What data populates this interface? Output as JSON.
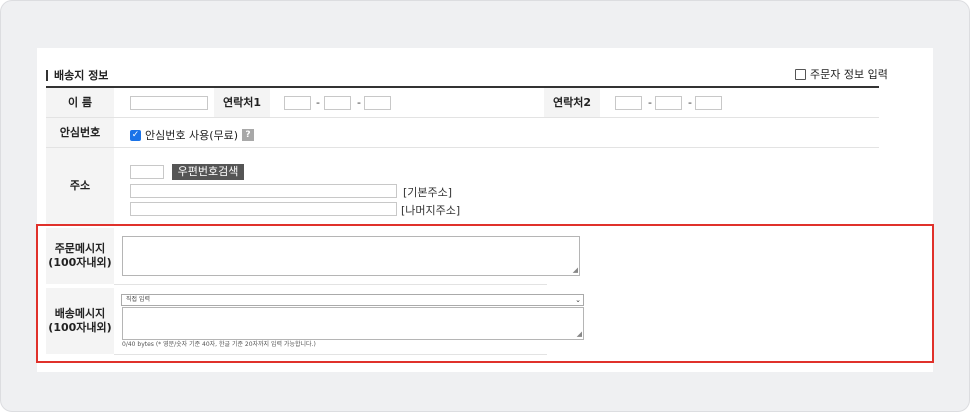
{
  "section": {
    "title": "배송지 정보",
    "orderer_checkbox_label": "주문자 정보 입력"
  },
  "fields": {
    "name_label": "이 름",
    "contact1_label": "연락처1",
    "contact2_label": "연락처2",
    "dash": "-",
    "safe_number_label": "안심번호",
    "safe_number_checkbox": "안심번호 사용(무료)",
    "help_icon_glyph": "?",
    "address_label": "주소",
    "zip_search_button": "우편번호검색",
    "base_address_hint": "[기본주소]",
    "detail_address_hint": "[나머지주소]",
    "order_message_label_line1": "주문메시지",
    "order_message_label_line2": "(100자내외)",
    "delivery_message_label_line1": "배송메시지",
    "delivery_message_label_line2": "(100자내외)",
    "delivery_select_value": "직접 입력",
    "bytes_info": "0/40 bytes (* 영문/숫자 기준 40자, 한글 기준 20자까지 입력 가능합니다.)"
  },
  "colors": {
    "highlight": "#e0312b",
    "label_bg": "#f4f4f4",
    "button_bg": "#555555",
    "checkbox_on": "#1a73e8"
  },
  "icons": {
    "checkbox_checked": "check-icon",
    "help": "question-icon",
    "dropdown": "chevron-down-icon",
    "resize": "resize-handle-icon"
  }
}
